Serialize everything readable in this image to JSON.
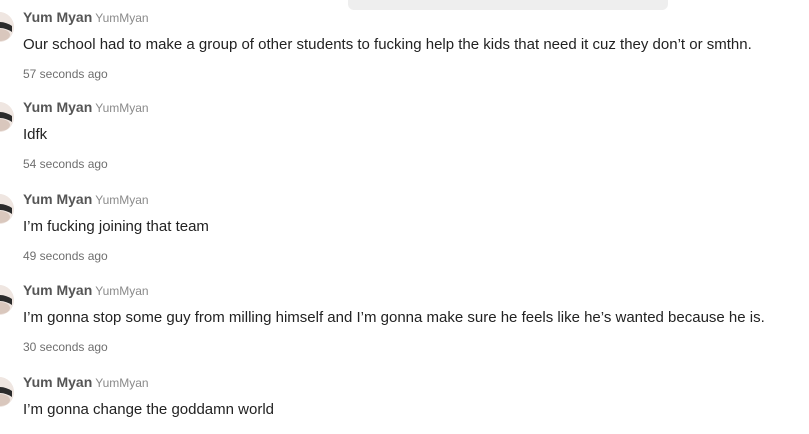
{
  "posts": [
    {
      "display_name": "Yum Myan",
      "username": "YumMyan",
      "text": "Our school had to make a group of other students to fucking help the kids that need it cuz they don’t or smthn.",
      "time": "57 seconds ago"
    },
    {
      "display_name": "Yum Myan",
      "username": "YumMyan",
      "text": "Idfk",
      "time": "54 seconds ago"
    },
    {
      "display_name": "Yum Myan",
      "username": "YumMyan",
      "text": "I’m fucking joining that team",
      "time": "49 seconds ago"
    },
    {
      "display_name": "Yum Myan",
      "username": "YumMyan",
      "text": "I’m gonna stop some guy from milling himself and I’m gonna make sure he feels like he’s wanted because he is.",
      "time": "30 seconds ago"
    },
    {
      "display_name": "Yum Myan",
      "username": "YumMyan",
      "text": "I’m gonna change the goddamn world",
      "time": ""
    }
  ]
}
